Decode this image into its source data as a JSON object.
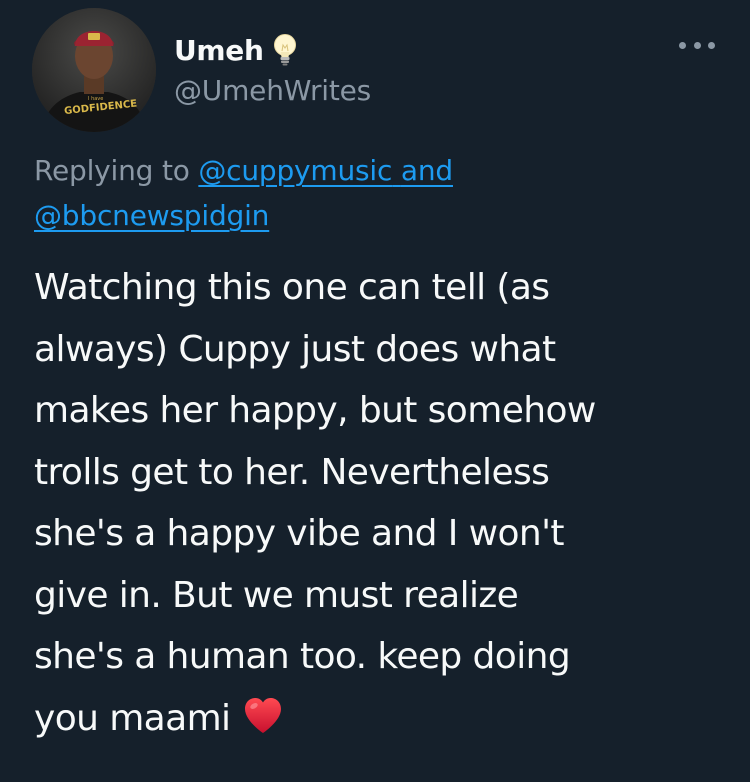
{
  "author": {
    "display_name": "Umeh",
    "badge_icon": "lightbulb-icon",
    "handle": "@UmehWrites",
    "avatar_shirt_text_small": "I have",
    "avatar_shirt_text": "GODFIDENCE"
  },
  "menu": {
    "icon": "more-options-icon"
  },
  "reply": {
    "prefix": "Replying to",
    "mention_1": "@cuppymusic",
    "conjunction": "and",
    "mention_2": "@bbcnewspidgin"
  },
  "tweet": {
    "text": "Watching this one can tell (as\nalways) Cuppy just does what\nmakes her happy, but somehow\ntrolls get to her. Nevertheless\nshe's a happy vibe and I won't\ngive in. But we must realize\nshe's a human too. keep doing\nyou maami",
    "emoji_icon": "red-heart-icon"
  },
  "colors": {
    "background": "#15202b",
    "primary_text": "#f7f9f9",
    "secondary_text": "#8b98a5",
    "link": "#1d9bf0",
    "heart": "#e0245e"
  }
}
